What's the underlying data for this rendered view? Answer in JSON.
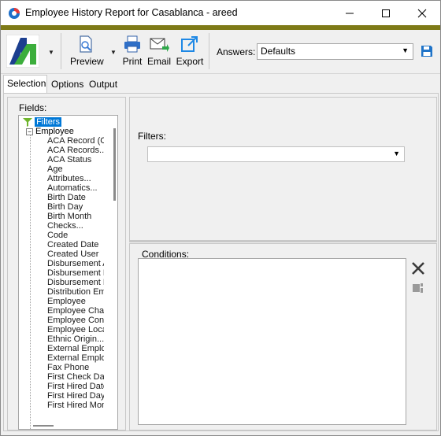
{
  "window": {
    "title": "Employee History Report for Casablanca - areed",
    "accent_color": "#7e7a17"
  },
  "toolbar": {
    "preview_label": "Preview",
    "print_label": "Print",
    "email_label": "Email",
    "export_label": "Export",
    "answers_label": "Answers:",
    "answers_value": "Defaults"
  },
  "tabs": [
    "Selection",
    "Options",
    "Output"
  ],
  "fields": {
    "label": "Fields:",
    "filters_node": "Filters",
    "employee_node": "Employee",
    "items": [
      "ACA Record (C",
      "ACA Records...",
      "ACA Status",
      "Age",
      "Attributes...",
      "Automatics...",
      "Birth Date",
      "Birth Day",
      "Birth Month",
      "Checks...",
      "Code",
      "Created Date",
      "Created User",
      "Disbursement A",
      "Disbursement L",
      "Disbursement F",
      "Distribution Em",
      "Employee",
      "Employee Char",
      "Employee Cont",
      "Employee Loca",
      "Ethnic Origin...",
      "External Emplo",
      "External Emplo",
      "Fax Phone",
      "First Check Da",
      "First Hired Date",
      "First Hired Day",
      "First Hired Mon"
    ]
  },
  "filters": {
    "label": "Filters:",
    "value": ""
  },
  "conditions": {
    "label": "Conditions:"
  },
  "icons": {
    "app": "pie-chart-icon",
    "logo": "brand-logo",
    "preview": "preview-document-icon",
    "print": "printer-icon",
    "email": "envelope-icon",
    "export": "export-icon",
    "save": "save-disk-icon",
    "delete": "close-x-icon",
    "edit": "edit-condition-icon"
  }
}
